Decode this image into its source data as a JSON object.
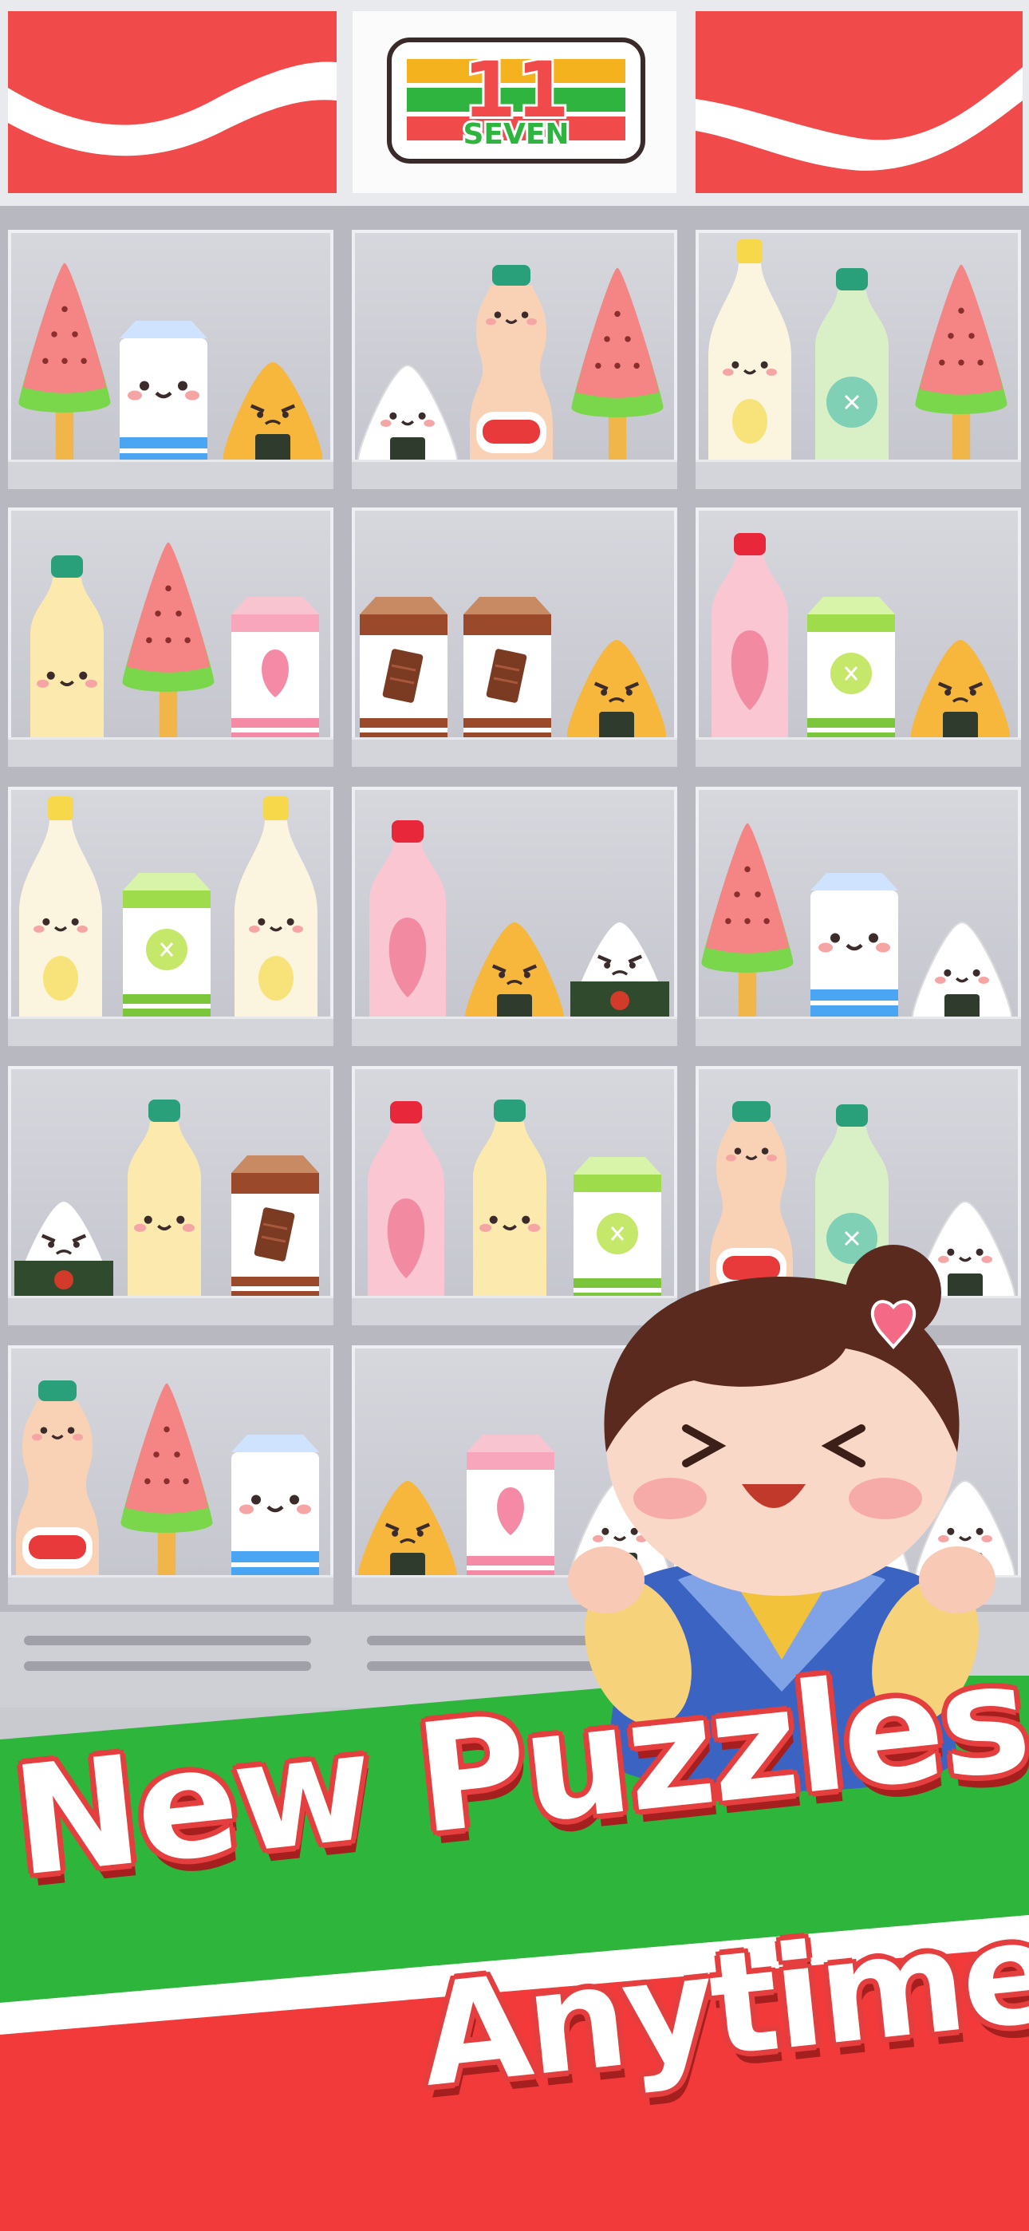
{
  "sign": {
    "logo_number": "11",
    "logo_word": "SEVEN"
  },
  "banner": {
    "line1": "New Puzzles",
    "line2": "Anytime!"
  },
  "colors": {
    "brand_red": "#f04a4a",
    "brand_green": "#2fb43f",
    "brand_orange": "#f5a020",
    "banner_red": "#f23a3a",
    "banner_green": "#2db53c"
  },
  "shelves": [
    [
      "watermelon-popsicle-icon",
      "milk-carton-blue-icon",
      "onigiri-orange-icon"
    ],
    [
      "onigiri-white-icon",
      "yakult-bottle-icon",
      "watermelon-popsicle-icon"
    ],
    [
      "mayo-bottle-icon",
      "melon-milk-bottle-icon",
      "watermelon-popsicle-icon"
    ],
    [
      "banana-milk-bottle-icon",
      "watermelon-popsicle-icon",
      "strawberry-carton-icon"
    ],
    [
      "chocolate-carton-icon",
      "chocolate-carton-icon",
      "onigiri-red-icon"
    ],
    [
      "strawberry-milk-bottle-icon",
      "melon-carton-icon",
      "onigiri-red-icon"
    ],
    [
      "mayo-bottle-icon",
      "melon-carton-icon",
      "mayo-bottle-icon"
    ],
    [
      "strawberry-milk-bottle-icon",
      "onigiri-orange-icon",
      "onigiri-seaweed-icon"
    ],
    [
      "watermelon-popsicle-icon",
      "milk-carton-blue-icon",
      "onigiri-white-icon"
    ],
    [
      "onigiri-seaweed-icon",
      "banana-milk-bottle-icon",
      "chocolate-carton-icon"
    ],
    [
      "strawberry-milk-bottle-icon",
      "banana-milk-bottle-icon",
      "melon-carton-icon"
    ],
    [
      "yakult-bottle-icon",
      "melon-milk-bottle-icon",
      "onigiri-white-icon"
    ],
    [
      "yakult-bottle-icon",
      "watermelon-popsicle-icon",
      "milk-carton-blue-icon"
    ],
    [
      "onigiri-orange-icon",
      "strawberry-carton-icon",
      "onigiri-white-icon"
    ],
    [
      "yakult-bottle-icon",
      "onigiri-white-icon",
      "onigiri-white-icon"
    ]
  ]
}
